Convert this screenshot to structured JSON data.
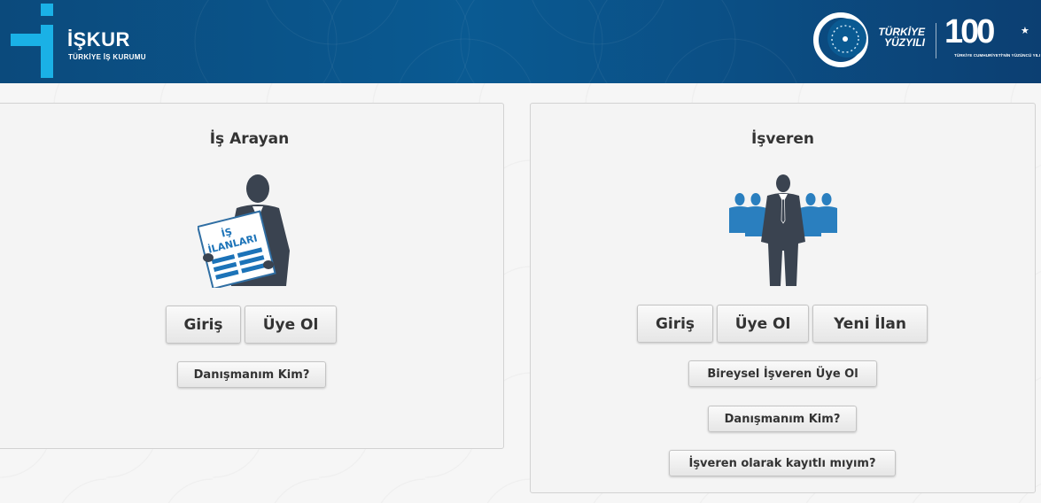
{
  "header": {
    "logo_title": "İŞKUR",
    "logo_subtitle": "TÜRKİYE İŞ KURUMU",
    "emblem_text_line1": "TÜRKİYE",
    "emblem_text_line2": "YÜZYILI",
    "anniversary_number": "100",
    "anniversary_caption": "TÜRKİYE CUMHURİYETİ'NİN YÜZÜNCÜ YILI",
    "brand_color": "#0b5a92"
  },
  "job_seeker": {
    "title": "İş Arayan",
    "newspaper_line1": "İŞ",
    "newspaper_line2": "İLANLARI",
    "icon": "man-reading-job-ads-icon",
    "login_label": "Giriş",
    "register_label": "Üye Ol",
    "advisor_label": "Danışmanım Kim?"
  },
  "employer": {
    "title": "İşveren",
    "icon": "employer-with-team-icon",
    "login_label": "Giriş",
    "register_label": "Üye Ol",
    "new_listing_label": "Yeni İlan",
    "individual_register_label": "Bireysel İşveren Üye Ol",
    "advisor_label": "Danışmanım Kim?",
    "registered_check_label": "İşveren olarak kayıtlı mıyım?"
  }
}
